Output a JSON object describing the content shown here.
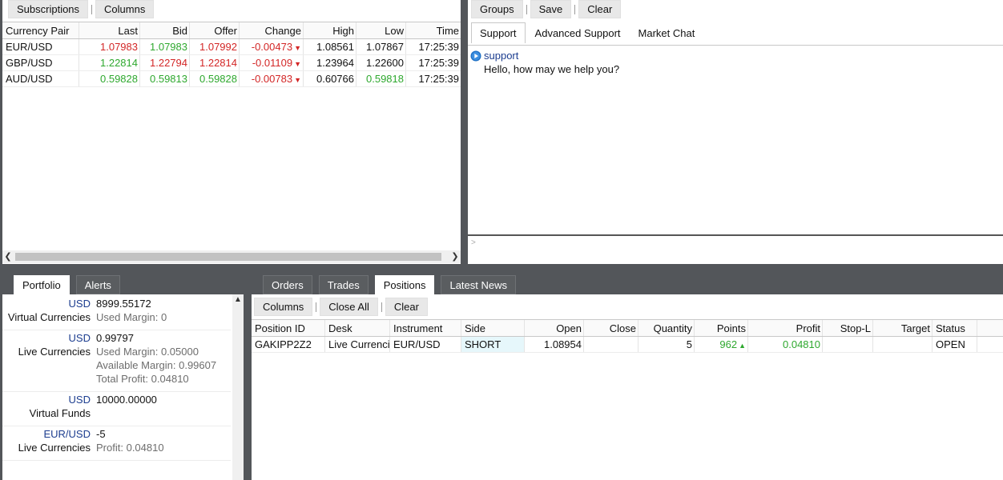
{
  "quotes": {
    "toolbar": {
      "subscriptions": "Subscriptions",
      "columns": "Columns"
    },
    "headers": [
      "Currency Pair",
      "Last",
      "Bid",
      "Offer",
      "Change",
      "High",
      "Low",
      "Time"
    ],
    "rows": [
      {
        "pair": "EUR/USD",
        "last": "1.07983",
        "bid": "1.07983",
        "offer": "1.07992",
        "change": "-0.00473",
        "high": "1.08561",
        "low": "1.07867",
        "time": "17:25:39",
        "colors": {
          "last": "#d32626",
          "bid": "#2ea82e",
          "offer": "#d32626",
          "change": "#d32626",
          "high": "#111111",
          "low": "#111111"
        }
      },
      {
        "pair": "GBP/USD",
        "last": "1.22814",
        "bid": "1.22794",
        "offer": "1.22814",
        "change": "-0.01109",
        "high": "1.23964",
        "low": "1.22600",
        "time": "17:25:39",
        "colors": {
          "last": "#2ea82e",
          "bid": "#d32626",
          "offer": "#d32626",
          "change": "#d32626",
          "high": "#111111",
          "low": "#111111"
        }
      },
      {
        "pair": "AUD/USD",
        "last": "0.59828",
        "bid": "0.59813",
        "offer": "0.59828",
        "change": "-0.00783",
        "high": "0.60766",
        "low": "0.59818",
        "time": "17:25:39",
        "colors": {
          "last": "#2ea82e",
          "bid": "#2ea82e",
          "offer": "#2ea82e",
          "change": "#d32626",
          "high": "#111111",
          "low": "#2ea82e"
        }
      }
    ],
    "down_arrow": "▼"
  },
  "chat": {
    "toolbar": {
      "groups": "Groups",
      "save": "Save",
      "clear": "Clear"
    },
    "tabs": [
      "Support",
      "Advanced Support",
      "Market Chat"
    ],
    "active_tab": "Support",
    "messages": [
      {
        "sender": "support",
        "text": "Hello, how may we help you?"
      }
    ],
    "input_prompt": ">"
  },
  "portfolio": {
    "tabs": [
      "Portfolio",
      "Alerts"
    ],
    "blocks": [
      {
        "currency": "USD",
        "name": "Virtual Currencies",
        "value": "8999.55172",
        "details": [
          {
            "label": "Used Margin:",
            "value": "0"
          }
        ]
      },
      {
        "currency": "USD",
        "name": "Live Currencies",
        "value": "0.99797",
        "details": [
          {
            "label": "Used Margin:",
            "value": "0.05000"
          },
          {
            "label": "Available Margin:",
            "value": "0.99607"
          },
          {
            "label": "Total Profit:",
            "value": "0.04810"
          }
        ]
      },
      {
        "currency": "USD",
        "name": "Virtual Funds",
        "value": "10000.00000",
        "details": []
      },
      {
        "currency": "EUR/USD",
        "name": "Live Currencies",
        "value": "-5",
        "details": [
          {
            "label": "Profit:",
            "value": "0.04810"
          }
        ]
      }
    ]
  },
  "positions": {
    "tabs": [
      "Orders",
      "Trades",
      "Positions",
      "Latest News"
    ],
    "active_tab": "Positions",
    "toolbar": {
      "columns": "Columns",
      "close_all": "Close All",
      "clear": "Clear"
    },
    "headers": [
      "Position ID",
      "Desk",
      "Instrument",
      "Side",
      "Open",
      "Close",
      "Quantity",
      "Points",
      "Profit",
      "Stop-L",
      "Target",
      "Status"
    ],
    "rows": [
      {
        "id": "GAKIPP2Z2",
        "desk": "Live Currencies",
        "instrument": "EUR/USD",
        "side": "SHORT",
        "open": "1.08954",
        "close": "",
        "quantity": "5",
        "points": "962",
        "profit": "0.04810",
        "stop": "",
        "target": "",
        "status": "OPEN"
      }
    ],
    "up_arrow": "▲",
    "colors": {
      "side_bg": "#e6f7fb",
      "points": "#2ea82e",
      "profit": "#2ea82e"
    }
  }
}
